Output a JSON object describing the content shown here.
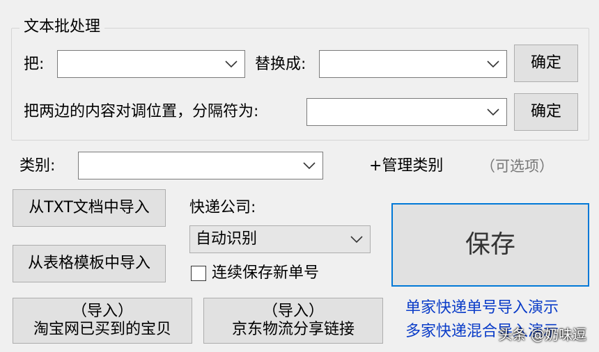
{
  "batch": {
    "title": "文本批处理",
    "replace_from_label": "把:",
    "replace_to_label": "替换成:",
    "confirm_label": "确定",
    "swap_label": "把两边的内容对调位置，分隔符为:",
    "swap_confirm_label": "确定"
  },
  "category": {
    "label": "类别:",
    "manage_label": "+管理类别",
    "optional_hint": "（可选项）"
  },
  "import": {
    "txt_label": "从TXT文档中导入",
    "template_label": "从表格模板中导入",
    "taobao_line1": "（导入）",
    "taobao_line2": "淘宝网已买到的宝贝",
    "jd_line1": "（导入）",
    "jd_line2": "京东物流分享链接"
  },
  "courier": {
    "label": "快递公司:",
    "selected": "自动识别"
  },
  "options": {
    "continuous_save_label": "连续保存新单号"
  },
  "save_label": "保存",
  "demos": {
    "single_label": "单家快递单号导入演示",
    "multi_label": "多家快递混合导入演示"
  },
  "watermark": "头条 @奶味逗",
  "colors": {
    "accent": "#0078d7",
    "link": "#0a3cc8"
  }
}
